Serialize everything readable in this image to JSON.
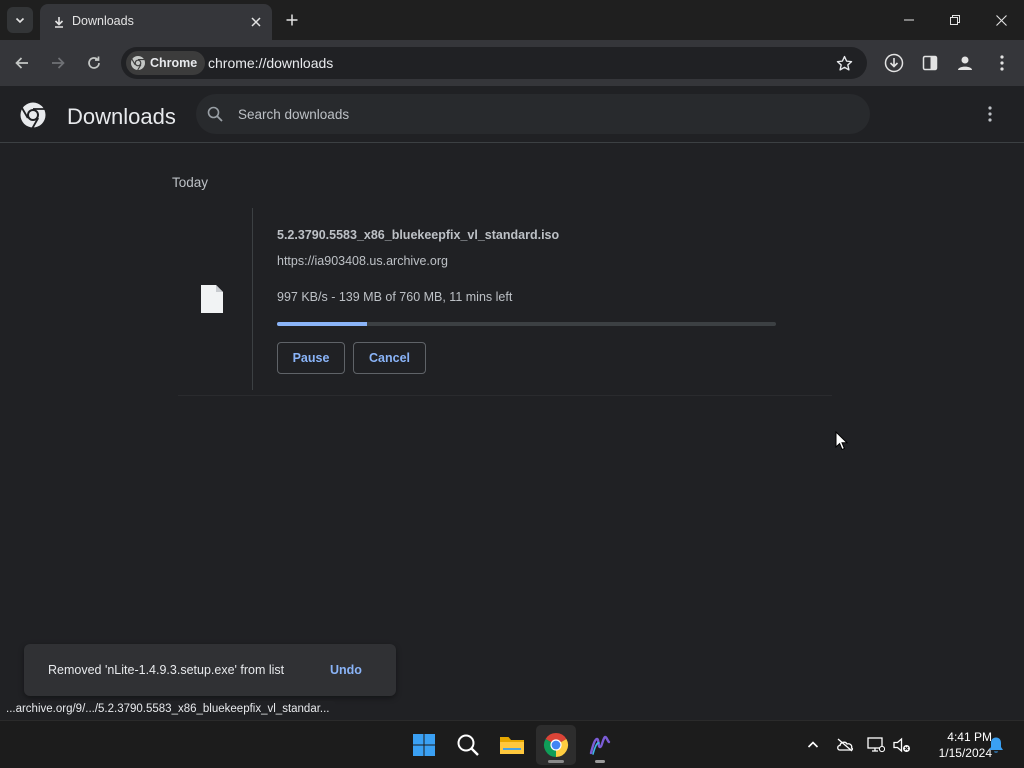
{
  "browser": {
    "tab": {
      "title": "Downloads"
    },
    "omnibox": {
      "chip_label": "Chrome",
      "url": "chrome://downloads"
    }
  },
  "header": {
    "title": "Downloads",
    "search": {
      "placeholder": "Search downloads",
      "value": ""
    }
  },
  "downloads": {
    "section": "Today",
    "items": [
      {
        "file_name": "5.2.3790.5583_x86_bluekeepfix_vl_standard.iso",
        "source_url": "https://ia903408.us.archive.org",
        "status": "997 KB/s - 139 MB of 760 MB, 11 mins left",
        "progress_fraction": 0.18,
        "pause_label": "Pause",
        "cancel_label": "Cancel"
      }
    ]
  },
  "toast": {
    "message": "Removed 'nLite-1.4.9.3.setup.exe' from list",
    "action": "Undo"
  },
  "status_bar": "...archive.org/9/.../5.2.3790.5583_x86_bluekeepfix_vl_standar...",
  "taskbar": {
    "time": "4:41 PM",
    "date": "1/15/2024",
    "apps": [
      "windows-start",
      "search",
      "file-explorer",
      "chrome",
      "nlite"
    ]
  },
  "colors": {
    "accent": "#8ab4f8",
    "background": "#202124",
    "toolbar": "#35363a",
    "tabstrip": "#1f1f1f"
  }
}
